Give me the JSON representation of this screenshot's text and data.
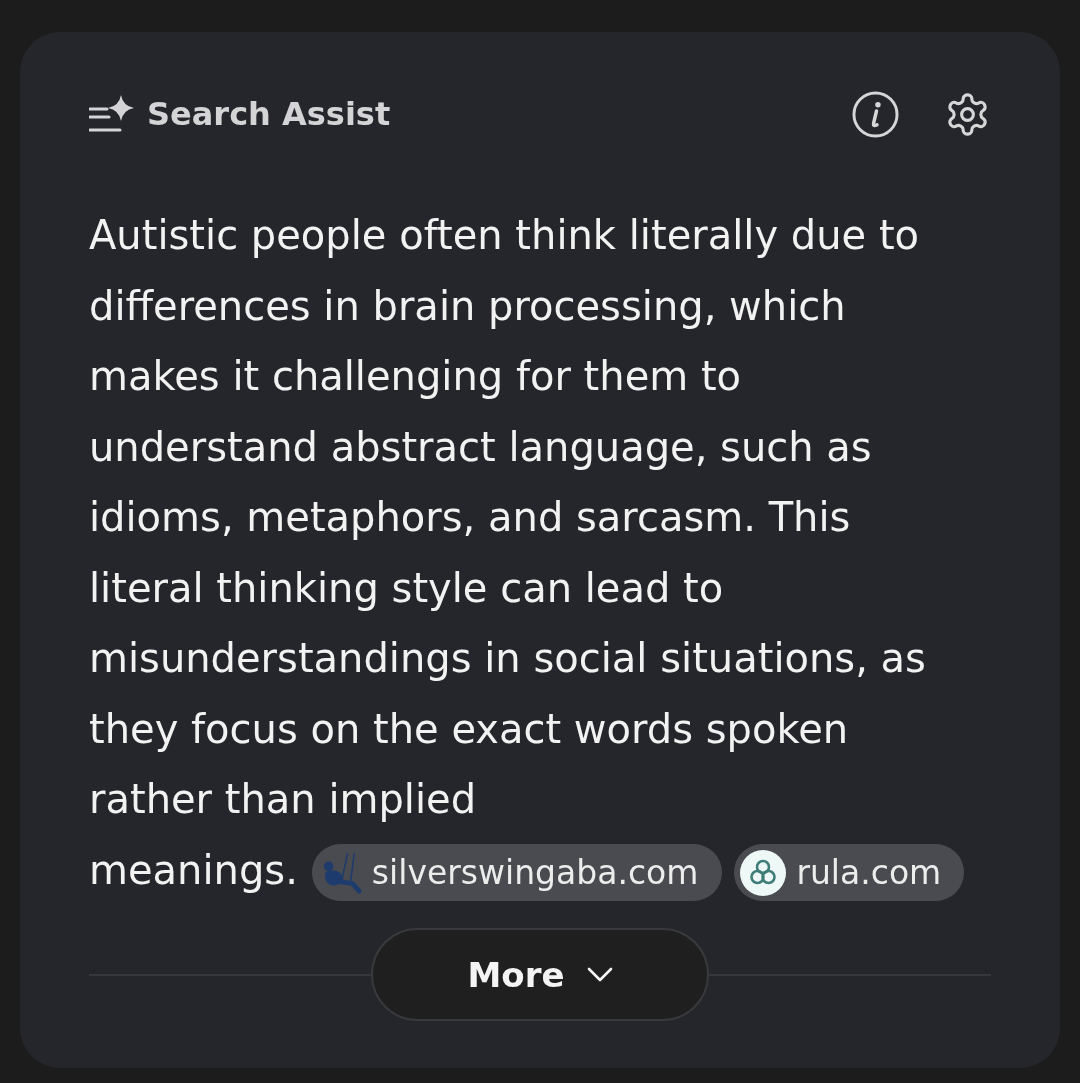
{
  "header": {
    "title": "Search Assist"
  },
  "answer": {
    "text": "Autistic people often think literally due to differences in brain processing, which makes it challenging for them to understand abstract language, such as idioms, metaphors, and sarcasm. This literal thinking style can lead to misunderstandings in social situations, as they focus on the exact words spoken rather than implied meanings.",
    "sources": [
      {
        "label": "silverswingaba.com",
        "kind": "swing"
      },
      {
        "label": "rula.com",
        "kind": "trefoil"
      }
    ]
  },
  "more_button": {
    "label": "More"
  }
}
